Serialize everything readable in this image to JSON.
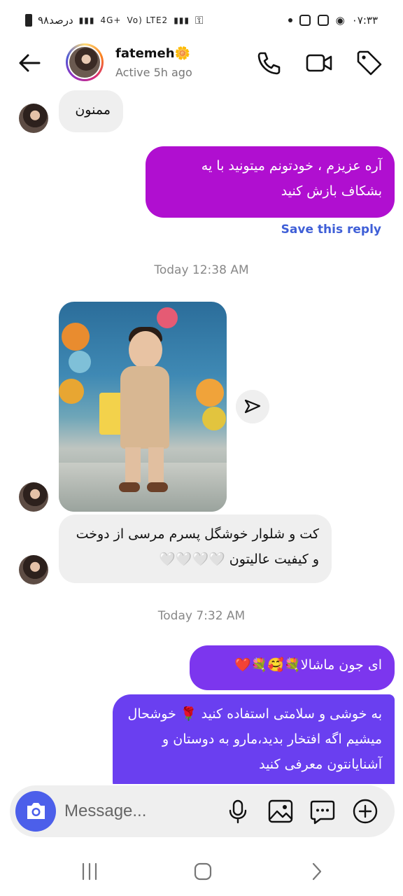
{
  "status_bar": {
    "time": "۰۷:۳۳",
    "battery_text": "۹۸درصد",
    "network_1": "4G+",
    "network_2": "Vo) LTE2"
  },
  "header": {
    "contact_name": "fatemeh🌼",
    "contact_status": "Active 5h ago"
  },
  "messages": {
    "msg1": "ممنون",
    "msg2": "آره عزیزم ، خودتونم میتونید با یه بشکاف بازش کنید",
    "save_reply": "Save this reply",
    "timestamp1": "Today 12:38 AM",
    "msg3": "کت و شلوار خوشگل پسرم مرسی از دوخت و کیفیت عالیتون 🤍🤍🤍🤍",
    "timestamp2": "Today 7:32 AM",
    "msg4": "ای جون ماشالا💐🥰💐❤️",
    "msg5": "به خوشی و سلامتی استفاده کنید 🌹 خوشحال میشیم اگه افتخار بدید،مارو به دوستان و آشنایانتون معرفی کنید"
  },
  "composer": {
    "placeholder": "Message..."
  },
  "colors": {
    "outgoing_purple": "#b00fd0",
    "outgoing_blue_violet": "#6a3ff0",
    "camera_blue": "#4c5fea",
    "save_reply_blue": "#3f5fd7"
  }
}
